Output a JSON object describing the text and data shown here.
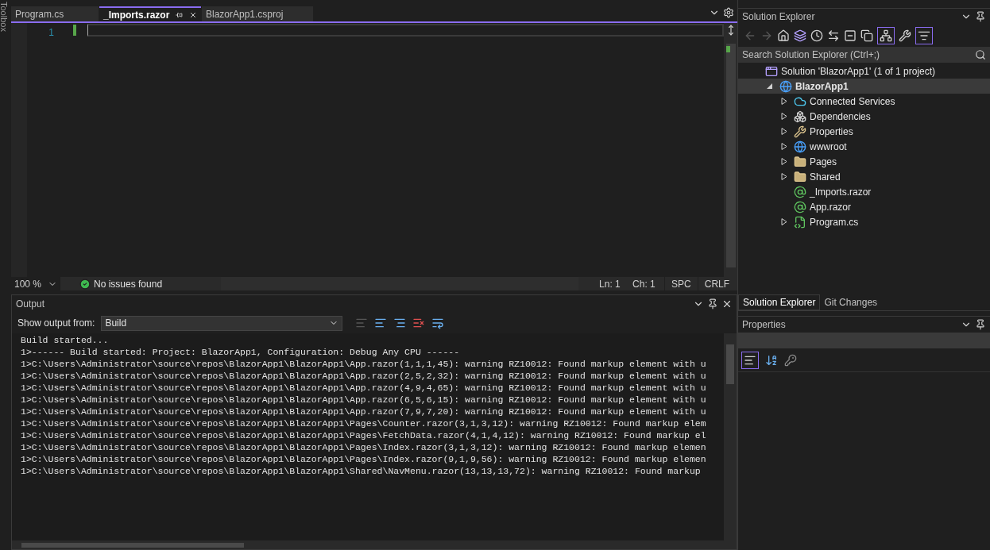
{
  "toolbox": {
    "label": "Toolbox"
  },
  "editor_tabs": [
    {
      "label": "Program.cs",
      "selected": false
    },
    {
      "label": "_Imports.razor",
      "selected": true
    },
    {
      "label": "BlazorApp1.csproj",
      "selected": false
    }
  ],
  "editor": {
    "line_numbers": [
      "1"
    ]
  },
  "status_bar": {
    "zoom": "100 %",
    "issues": "No issues found",
    "line": "Ln: 1",
    "column": "Ch: 1",
    "whitespace": "SPC",
    "line_ending": "CRLF"
  },
  "output": {
    "title": "Output",
    "source_label": "Show output from:",
    "source": "Build",
    "lines": [
      "Build started...",
      "1>------ Build started: Project: BlazorApp1, Configuration: Debug Any CPU ------",
      "1>C:\\Users\\Administrator\\source\\repos\\BlazorApp1\\BlazorApp1\\App.razor(1,1,1,45): warning RZ10012: Found markup element with u",
      "1>C:\\Users\\Administrator\\source\\repos\\BlazorApp1\\BlazorApp1\\App.razor(2,5,2,32): warning RZ10012: Found markup element with u",
      "1>C:\\Users\\Administrator\\source\\repos\\BlazorApp1\\BlazorApp1\\App.razor(4,9,4,65): warning RZ10012: Found markup element with u",
      "1>C:\\Users\\Administrator\\source\\repos\\BlazorApp1\\BlazorApp1\\App.razor(6,5,6,15): warning RZ10012: Found markup element with u",
      "1>C:\\Users\\Administrator\\source\\repos\\BlazorApp1\\BlazorApp1\\App.razor(7,9,7,20): warning RZ10012: Found markup element with u",
      "1>C:\\Users\\Administrator\\source\\repos\\BlazorApp1\\BlazorApp1\\Pages\\Counter.razor(3,1,3,12): warning RZ10012: Found markup elem",
      "1>C:\\Users\\Administrator\\source\\repos\\BlazorApp1\\BlazorApp1\\Pages\\FetchData.razor(4,1,4,12): warning RZ10012: Found markup el",
      "1>C:\\Users\\Administrator\\source\\repos\\BlazorApp1\\BlazorApp1\\Pages\\Index.razor(3,1,3,12): warning RZ10012: Found markup elemen",
      "1>C:\\Users\\Administrator\\source\\repos\\BlazorApp1\\BlazorApp1\\Pages\\Index.razor(9,1,9,56): warning RZ10012: Found markup elemen",
      "1>C:\\Users\\Administrator\\source\\repos\\BlazorApp1\\BlazorApp1\\Shared\\NavMenu.razor(13,13,13,72): warning RZ10012: Found markup"
    ]
  },
  "solution_explorer": {
    "title": "Solution Explorer",
    "search": {
      "placeholder": "Search Solution Explorer (Ctrl+;)"
    },
    "tree": [
      {
        "label": "Solution 'BlazorApp1' (1 of 1 project)",
        "children": [
          {
            "label": "BlazorApp1",
            "kind": "branch",
            "expanded": true,
            "selected": true,
            "children": [
              {
                "label": "Connected Services",
                "kind": "branch",
                "expanded": false,
                "selected": false
              },
              {
                "label": "Dependencies",
                "kind": "branch",
                "expanded": false,
                "selected": false
              },
              {
                "label": "Properties",
                "kind": "branch",
                "expanded": false,
                "selected": false
              },
              {
                "label": "wwwroot",
                "kind": "branch",
                "expanded": false,
                "selected": false
              },
              {
                "label": "Pages",
                "kind": "branch",
                "expanded": false,
                "selected": false
              },
              {
                "label": "Shared",
                "kind": "branch",
                "expanded": false,
                "selected": false
              },
              {
                "label": "_Imports.razor",
                "kind": "leaf",
                "selected": false
              },
              {
                "label": "App.razor",
                "kind": "leaf",
                "selected": false
              },
              {
                "label": "Program.cs",
                "kind": "branch",
                "expanded": false,
                "selected": false
              }
            ]
          }
        ]
      }
    ]
  },
  "panel_tabs": [
    {
      "label": "Solution Explorer",
      "selected": true
    },
    {
      "label": "Git Changes",
      "selected": false
    }
  ],
  "properties": {
    "title": "Properties"
  }
}
